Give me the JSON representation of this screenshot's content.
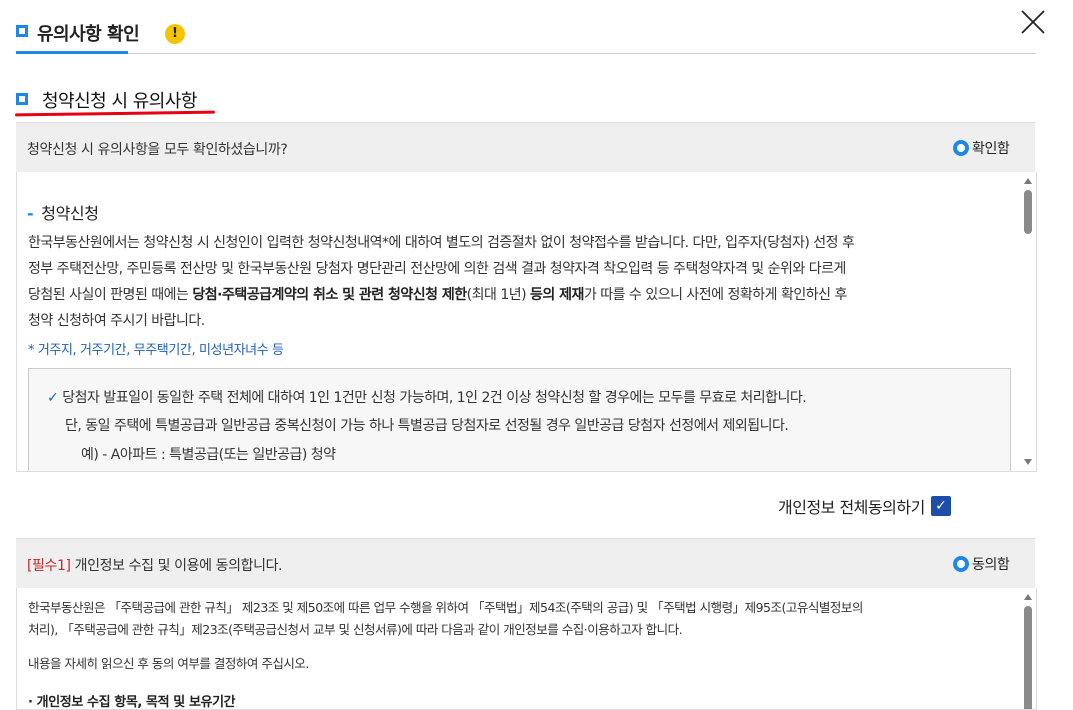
{
  "dialog": {
    "title": "유의사항 확인",
    "warning_glyph": "!",
    "close_glyph": "✕"
  },
  "section": {
    "title": "청약신청 시 유의사항"
  },
  "notice": {
    "question": "청약신청 시 유의사항을 모두 확인하셨습니까?",
    "confirm_label": "확인함",
    "heading": "청약신청",
    "body_1": "한국부동산원에서는 청약신청 시 신청인이 입력한 청약신청내역*에 대하여 별도의 검증절차 없이 청약접수를 받습니다. 다만, 입주자(당첨자) 선정 후",
    "body_2": "정부 주택전산망, 주민등록 전산망 및 한국부동산원 당첨자 명단관리 전산망에 의한 검색 결과 청약자격 착오입력 등 주택청약자격 및 순위와 다르게",
    "body_3_pre": "당첨된 사실이 판명된 때에는 ",
    "body_3_bold1": "당첨·주택공급계약의 취소 및 관련 청약신청 제한",
    "body_3_mid": "(최대 1년) ",
    "body_3_bold2": "등의 제재",
    "body_3_post": "가 따를 수 있으니 사전에 정확하게 확인하신 후",
    "body_4": "청약 신청하여 주시기 바랍니다.",
    "footnote": "* 거주지, 거주기간, 무주택기간, 미성년자녀수 등",
    "check_mark": "✓",
    "check_1": "당첨자 발표일이 동일한 주택 전체에 대하여 1인 1건만 신청 가능하며, 1인 2건 이상 청약신청 할 경우에는 모두를 무효로 처리합니다.",
    "check_2": "단, 동일 주택에 특별공급과 일반공급 중복신청이 가능 하나 특별공급 당첨자로 선정될 경우 일반공급 당첨자 선정에서 제외됩니다.",
    "example": "예) -  A아파트 : 특별공급(또는 일반공급) 청약"
  },
  "agree_all": {
    "label": "개인정보 전체동의하기",
    "checked_glyph": "✓"
  },
  "privacy": {
    "required_tag": "[필수1]",
    "question": " 개인정보 수집 및 이용에 동의합니다.",
    "agree_label": "동의함",
    "text_1": "한국부동산원은 「주택공급에 관한 규칙」 제23조 및 제50조에 따른 업무 수행을 위하여 「주택법」제54조(주택의 공급) 및 「주택법 시행령」제95조(고유식별정보의",
    "text_2": "처리), 「주택공급에 관한 규칙」제23조(주택공급신청서 교부 및 신청서류)에 따라 다음과 같이 개인정보를 수집·이용하고자 합니다.",
    "text_3": "내용을 자세히 읽으신 후 동의 여부를 결정하여 주십시오.",
    "bullet_head": "· 개인정보 수집 항목, 목적 및 보유기간"
  },
  "colors": {
    "accent": "#1e88e5",
    "underline_red": "#e60012",
    "required_red": "#c62828",
    "checkbox": "#1e4fa8"
  }
}
